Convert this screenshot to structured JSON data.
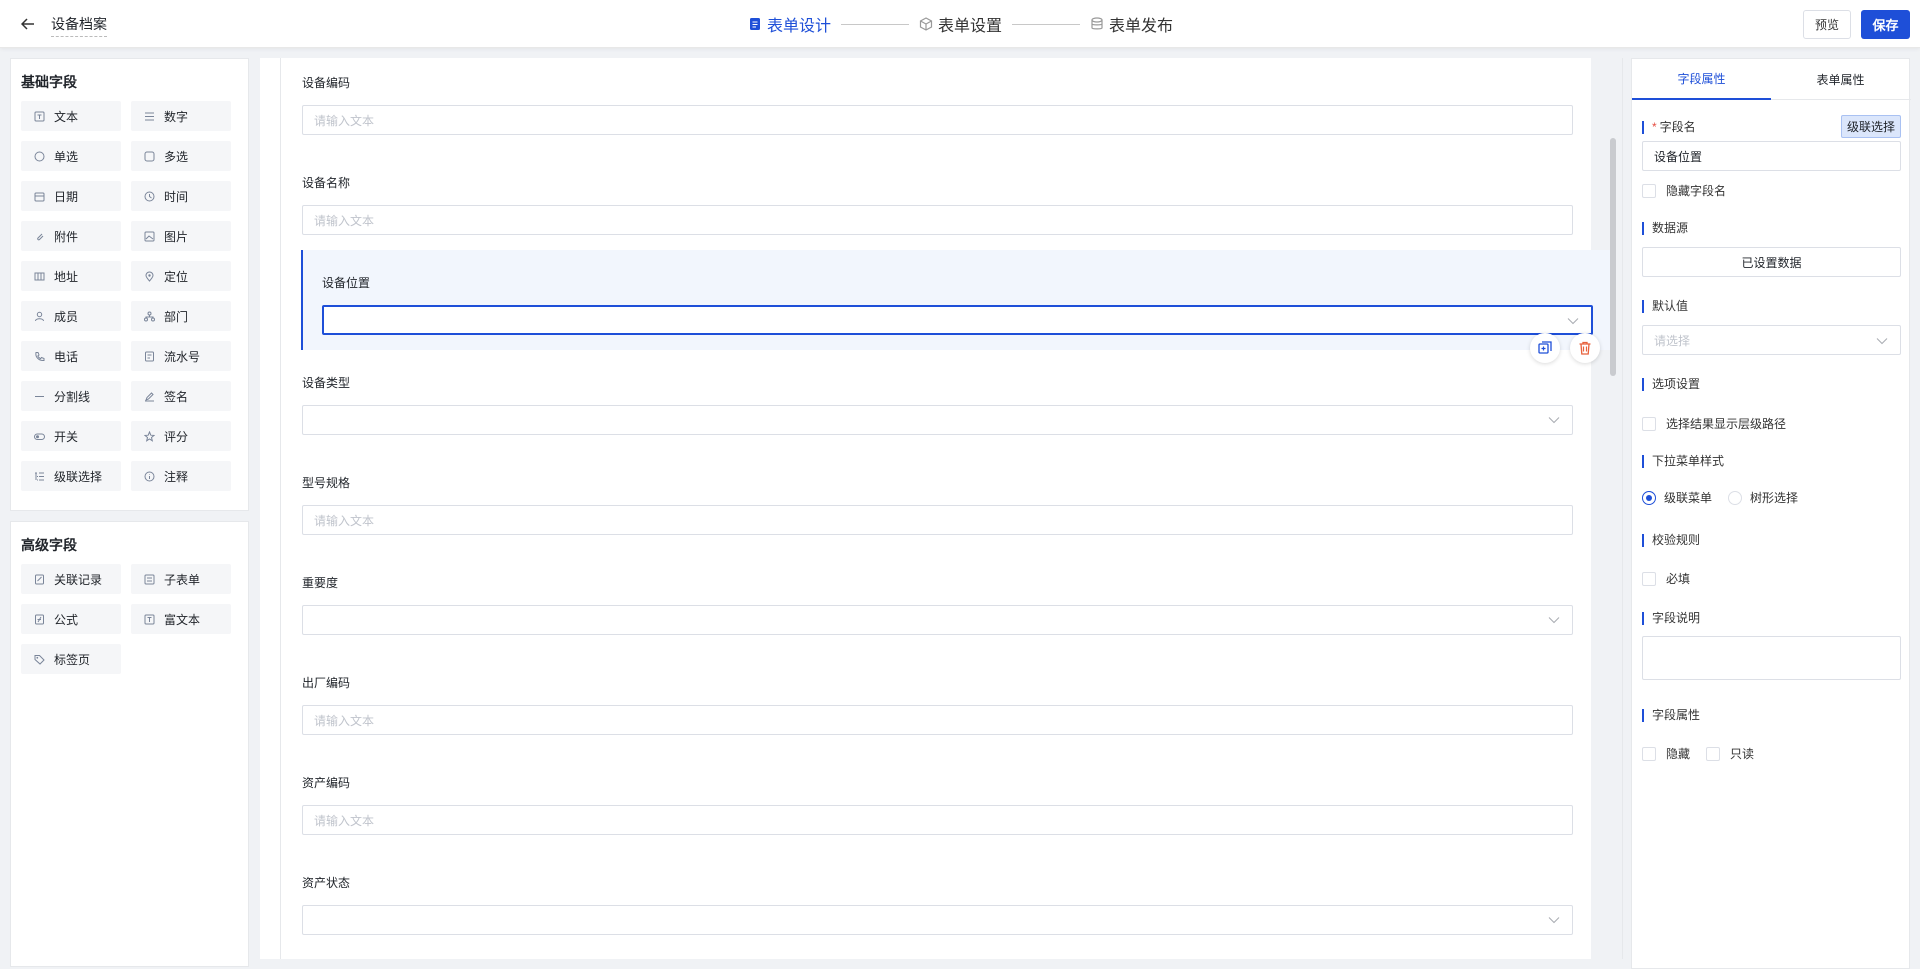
{
  "header": {
    "title": "设备档案",
    "steps": [
      {
        "label": "表单设计",
        "active": true
      },
      {
        "label": "表单设置",
        "active": false
      },
      {
        "label": "表单发布",
        "active": false
      }
    ],
    "preview_label": "预览",
    "save_label": "保存"
  },
  "basic_fields": {
    "title": "基础字段",
    "items": [
      "文本",
      "数字",
      "单选",
      "多选",
      "日期",
      "时间",
      "附件",
      "图片",
      "地址",
      "定位",
      "成员",
      "部门",
      "电话",
      "流水号",
      "分割线",
      "签名",
      "开关",
      "评分",
      "级联选择",
      "注释"
    ]
  },
  "advanced_fields": {
    "title": "高级字段",
    "items": [
      "关联记录",
      "子表单",
      "公式",
      "富文本",
      "标签页"
    ]
  },
  "form": {
    "fields": [
      {
        "label": "设备编码",
        "placeholder": "请输入文本"
      },
      {
        "label": "设备名称",
        "placeholder": "请输入文本"
      },
      {
        "label": "设备位置",
        "placeholder": ""
      },
      {
        "label": "设备类型",
        "placeholder": ""
      },
      {
        "label": "型号规格",
        "placeholder": "请输入文本"
      },
      {
        "label": "重要度",
        "placeholder": ""
      },
      {
        "label": "出厂编码",
        "placeholder": "请输入文本"
      },
      {
        "label": "资产编码",
        "placeholder": "请输入文本"
      },
      {
        "label": "资产状态",
        "placeholder": ""
      }
    ]
  },
  "props": {
    "tab_field": "字段属性",
    "tab_form": "表单属性",
    "field_name_label": "字段名",
    "field_type_badge": "级联选择",
    "field_name_value": "设备位置",
    "hide_name_label": "隐藏字段名",
    "datasource_label": "数据源",
    "datasource_button": "已设置数据",
    "default_label": "默认值",
    "default_placeholder": "请选择",
    "options_label": "选项设置",
    "show_path_label": "选择结果显示层级路径",
    "dropdown_style_label": "下拉菜单样式",
    "radio_cascade": "级联菜单",
    "radio_tree": "树形选择",
    "validation_label": "校验规则",
    "required_label": "必填",
    "desc_label": "字段说明",
    "attr_label": "字段属性",
    "hidden_label": "隐藏",
    "readonly_label": "只读"
  },
  "colors": {
    "accent": "#1e4fd8",
    "danger": "#e8613c"
  }
}
